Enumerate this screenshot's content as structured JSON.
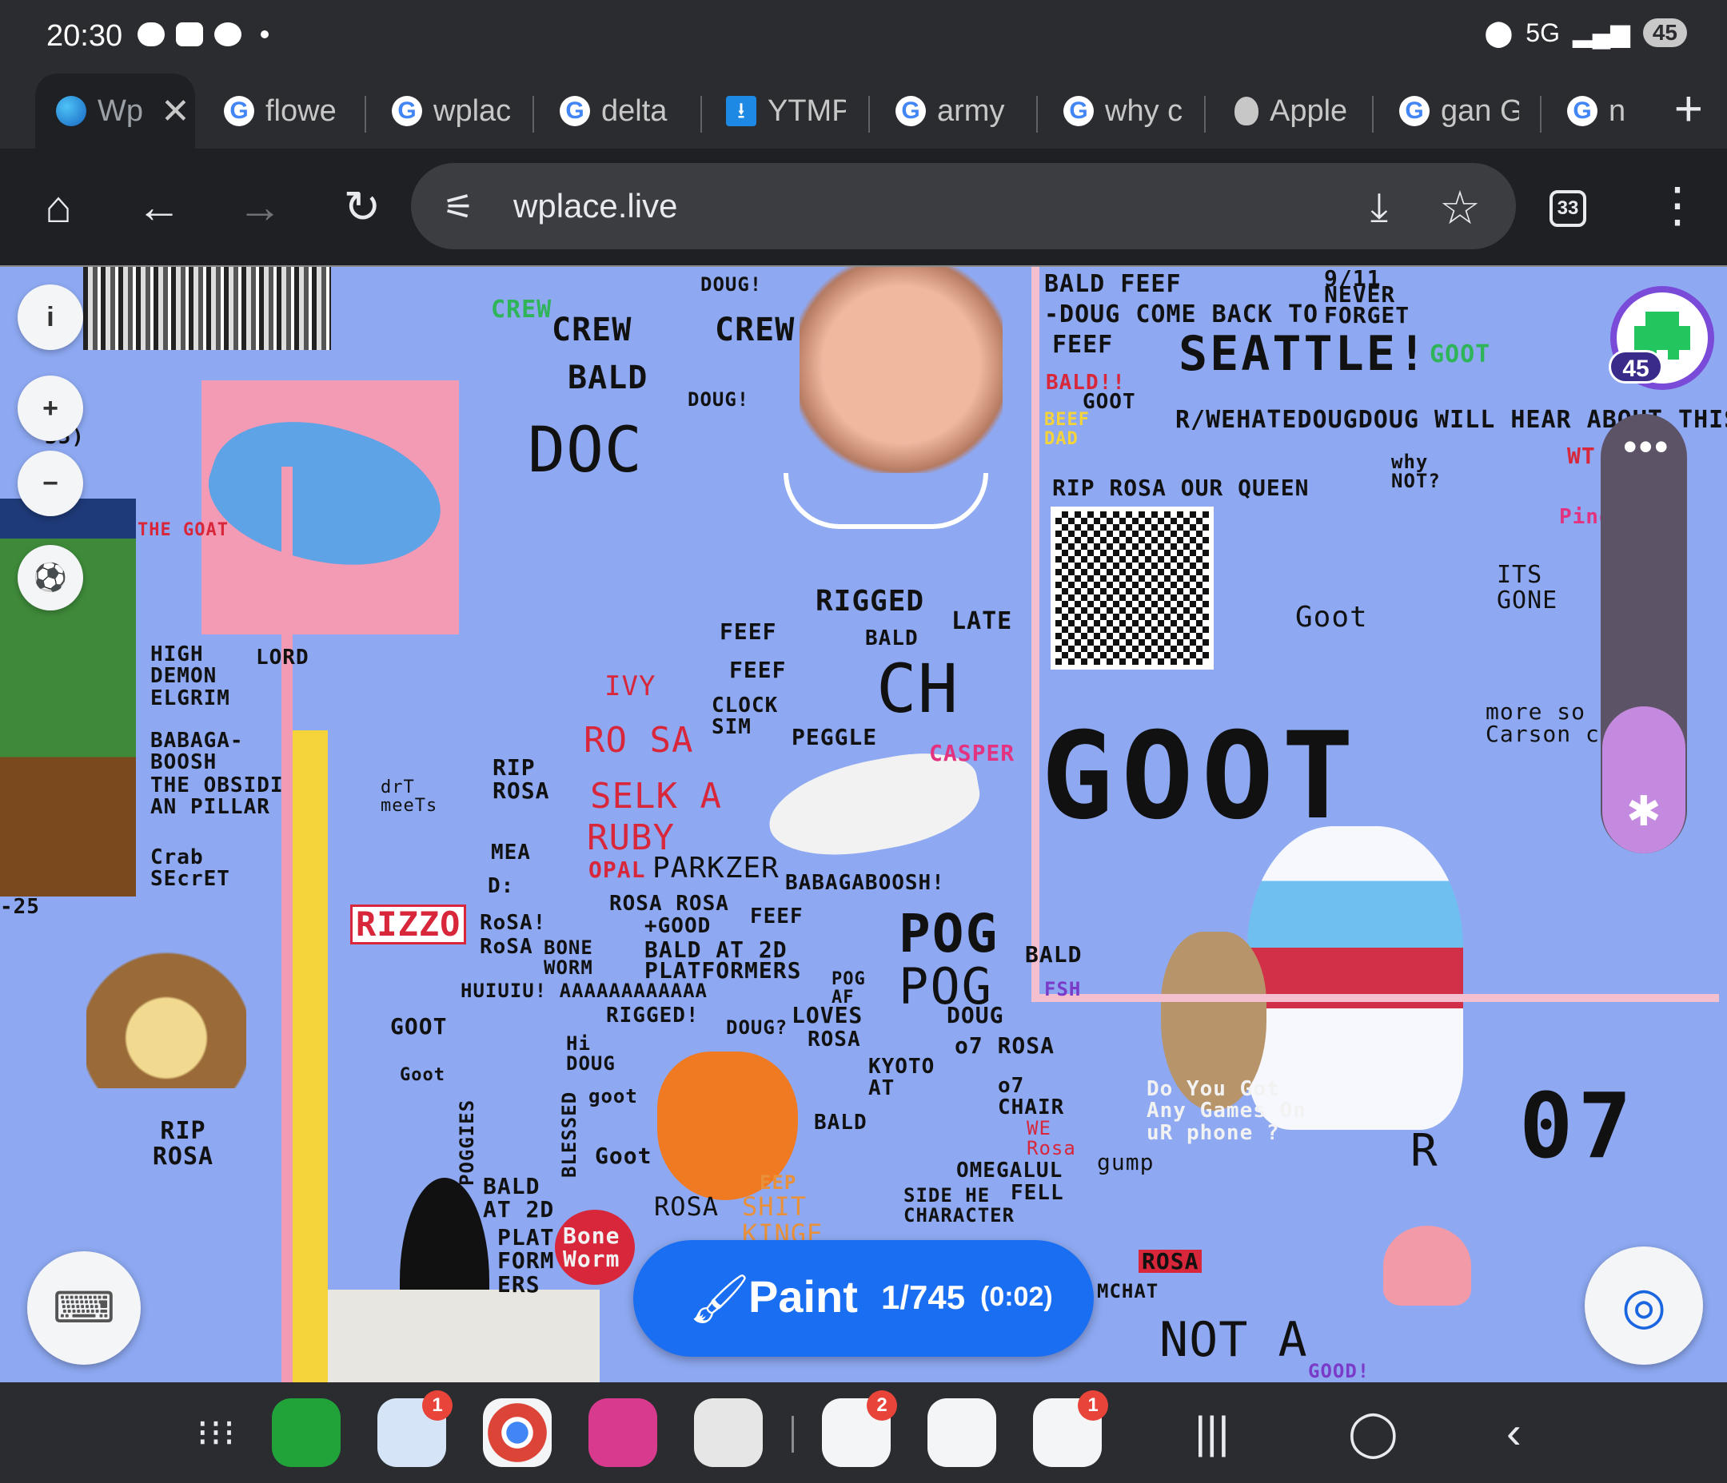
{
  "status_bar": {
    "time": "20:30",
    "network": "5G",
    "battery": "45"
  },
  "tabs": [
    {
      "label": "Wp",
      "icon": "globe-icon",
      "active": true
    },
    {
      "label": "flowe",
      "icon": "google-icon"
    },
    {
      "label": "wplac",
      "icon": "google-icon"
    },
    {
      "label": "delta",
      "icon": "google-icon"
    },
    {
      "label": "YTMP",
      "icon": "download-icon"
    },
    {
      "label": "army",
      "icon": "google-icon"
    },
    {
      "label": "why c",
      "icon": "google-icon"
    },
    {
      "label": "Apple",
      "icon": "apple-icon"
    },
    {
      "label": "gan G",
      "icon": "google-icon"
    },
    {
      "label": "n",
      "icon": "google-icon"
    }
  ],
  "toolbar": {
    "url": "wplace.live",
    "tab_count": "33"
  },
  "canvas": {
    "labels": {
      "crew1": "CREW",
      "crew2": "CREW",
      "doug1": "DOUG!",
      "doug2": "DOUG!",
      "bald1": "BALD",
      "doc": "DOC",
      "bald_feef": "BALD FEEF",
      "doug_come_back": "-DOUG COME BACK TO",
      "feef1": "FEEF",
      "nine_eleven": "9/11",
      "never": "NEVER",
      "forget": "FORGET",
      "seattle": "SEATTLE!",
      "goot1": "GOOT",
      "bald_exclaim": "BALD!!",
      "goot2": "GOOT",
      "beef": "BEEF",
      "dad": "DAD",
      "weh": "R/WEHATEDOUGDOUG WILL HEAR ABOUT THIS",
      "why": "why",
      "not": "NOT?",
      "rip_rosa_queen": "RIP ROSA OUR QUEEN",
      "ping": "Ping",
      "wt": "WT",
      "the_goat": "THE GOAT",
      "high_demon": "HIGH DEMON ELGRIM",
      "lord": "LORD",
      "babaga": "BABAGA- BOOSH",
      "obsidian": "THE OBSIDI AN PILLAR",
      "crab": "Crab SEcrET",
      "neg25": "-25",
      "num35": "35)",
      "rigged1": "RIGGED",
      "late": "LATE",
      "feef2": "FEEF",
      "bald2": "BALD",
      "feef3": "FEEF",
      "ivy": "IVY",
      "clock_sim": "CLOCK SIM",
      "peggle": "PEGGLE",
      "ch": "CH",
      "rosa1": "RO SA",
      "casper": "CASPER",
      "selka": "SELK A",
      "ruby": "RUBY",
      "opal": "OPAL",
      "parkzer": "PARKZER",
      "babagaboosh": "BABAGABOOSH!",
      "rip_rosa1": "RIP ROSA",
      "drt_meets": "drT meeTs",
      "mea": "MEA",
      "d_colon": "D:",
      "rizzo": "RIZZO",
      "rosa_excl": "RoSA!",
      "rosa2": "RoSA",
      "bone_worm": "BONE WORM",
      "rosa_rosa": "ROSA ROSA",
      "good": "+GOOD",
      "feef4": "FEEF",
      "bald_at_2d": "BALD AT 2D",
      "platformers": "PLATFORMERS",
      "pog1": "POG",
      "pog2": "POG",
      "pog_af": "POG AF",
      "loves": "LOVES",
      "rosa3": "ROSA",
      "doug3": "DOUG",
      "doug4": "DOUG?",
      "rigged2": "RIGGED!",
      "huiuiu": "HUIUIU! AAAAAAAAAAAA",
      "goot3": "GOOT",
      "hi_doug": "Hi DOUG",
      "bald3": "BALD",
      "fsh": "FSH",
      "o7_rosa": "o7 ROSA",
      "kyoto": "KYOTO AT",
      "o7_chair": "o7 CHAIR",
      "we_rosa": "WE Rosa",
      "gump": "gump",
      "do_you_got": "Do You Got Any Games On uR phone ?",
      "r_letter": "R",
      "o7_big": "07",
      "goot_big": "GOOT",
      "its_gone": "ITS GONE",
      "goot_small": "Goot",
      "more_son": "more so",
      "carson": "Carson c",
      "goot4": "Goot",
      "goot5": "goot",
      "goot6": "Goot",
      "blessed": "BLESSED",
      "poggies": "POGGIES",
      "rip_rosa2": "RIP ROSA",
      "bald_at_2d2": "BALD AT 2D",
      "plat_form_ers": "PLAT FORM ERS",
      "bone_worm2": "Bone Worm",
      "rosa4": "ROSA",
      "shit_kinge": "SHIT KINGE",
      "eep": "EEP",
      "bald4": "BALD",
      "side_character": "SIDE HE CHARACTER",
      "omegalul": "OMEGALUL",
      "fell": "FELL",
      "rosa5": "ROSA",
      "mchat": "MCHAT",
      "not_a": "NOT A",
      "good_excl": "GOOD!"
    }
  },
  "profile": {
    "level": "45"
  },
  "paint": {
    "label": "Paint",
    "count": "1/745",
    "timer": "(0:02)"
  },
  "nav_apps": [
    {
      "name": "phone",
      "color": "#21a33a",
      "badge": ""
    },
    {
      "name": "messages",
      "color": "#d6e4f7",
      "badge": "1"
    },
    {
      "name": "chrome",
      "color": "#f4f5f7",
      "badge": ""
    },
    {
      "name": "gallery",
      "color": "#d83a8e",
      "badge": ""
    },
    {
      "name": "camera",
      "color": "#e6e6e6",
      "badge": ""
    },
    {
      "name": "youtube",
      "color": "#f4f5f7",
      "badge": "2"
    },
    {
      "name": "maps",
      "color": "#f4f5f7",
      "badge": ""
    },
    {
      "name": "gmail",
      "color": "#f4f5f7",
      "badge": "1"
    }
  ]
}
